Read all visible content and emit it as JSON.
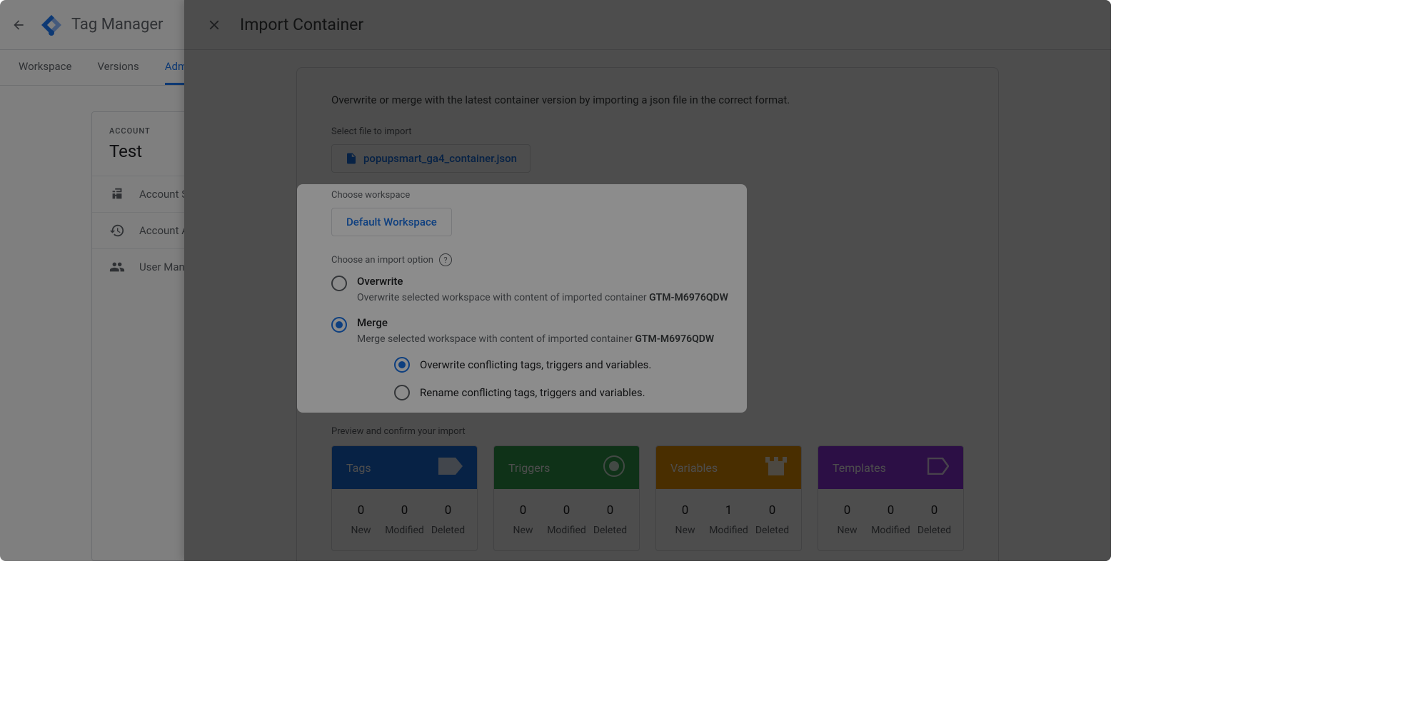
{
  "app": {
    "title": "Tag Manager",
    "tabs": [
      "Workspace",
      "Versions",
      "Admin"
    ]
  },
  "sidebar": {
    "accountLabel": "ACCOUNT",
    "accountName": "Test",
    "items": [
      {
        "label": "Account Settings"
      },
      {
        "label": "Account Activity"
      },
      {
        "label": "User Management"
      }
    ]
  },
  "panel": {
    "title": "Import Container",
    "intro": "Overwrite or merge with the latest container version by importing a json file in the correct format.",
    "selectFileLabel": "Select file to import",
    "fileName": "popupsmart_ga4_container.json",
    "chooseWorkspaceLabel": "Choose workspace",
    "workspaceName": "Default Workspace",
    "chooseOptionLabel": "Choose an import option",
    "overwrite": {
      "title": "Overwrite",
      "descPrefix": "Overwrite selected workspace with content of imported container ",
      "containerId": "GTM-M6976QDW"
    },
    "merge": {
      "title": "Merge",
      "descPrefix": "Merge selected workspace with content of imported container ",
      "containerId": "GTM-M6976QDW",
      "subOptions": [
        "Overwrite conflicting tags, triggers and variables.",
        "Rename conflicting tags, triggers and variables."
      ]
    },
    "previewLabel": "Preview and confirm your import",
    "preview": [
      {
        "name": "Tags",
        "type": "tags",
        "new": "0",
        "modified": "0",
        "deleted": "0"
      },
      {
        "name": "Triggers",
        "type": "triggers",
        "new": "0",
        "modified": "0",
        "deleted": "0"
      },
      {
        "name": "Variables",
        "type": "variables",
        "new": "0",
        "modified": "1",
        "deleted": "0"
      },
      {
        "name": "Templates",
        "type": "templates",
        "new": "0",
        "modified": "0",
        "deleted": "0"
      }
    ],
    "statLabels": {
      "new": "New",
      "modified": "Modified",
      "deleted": "Deleted"
    }
  }
}
